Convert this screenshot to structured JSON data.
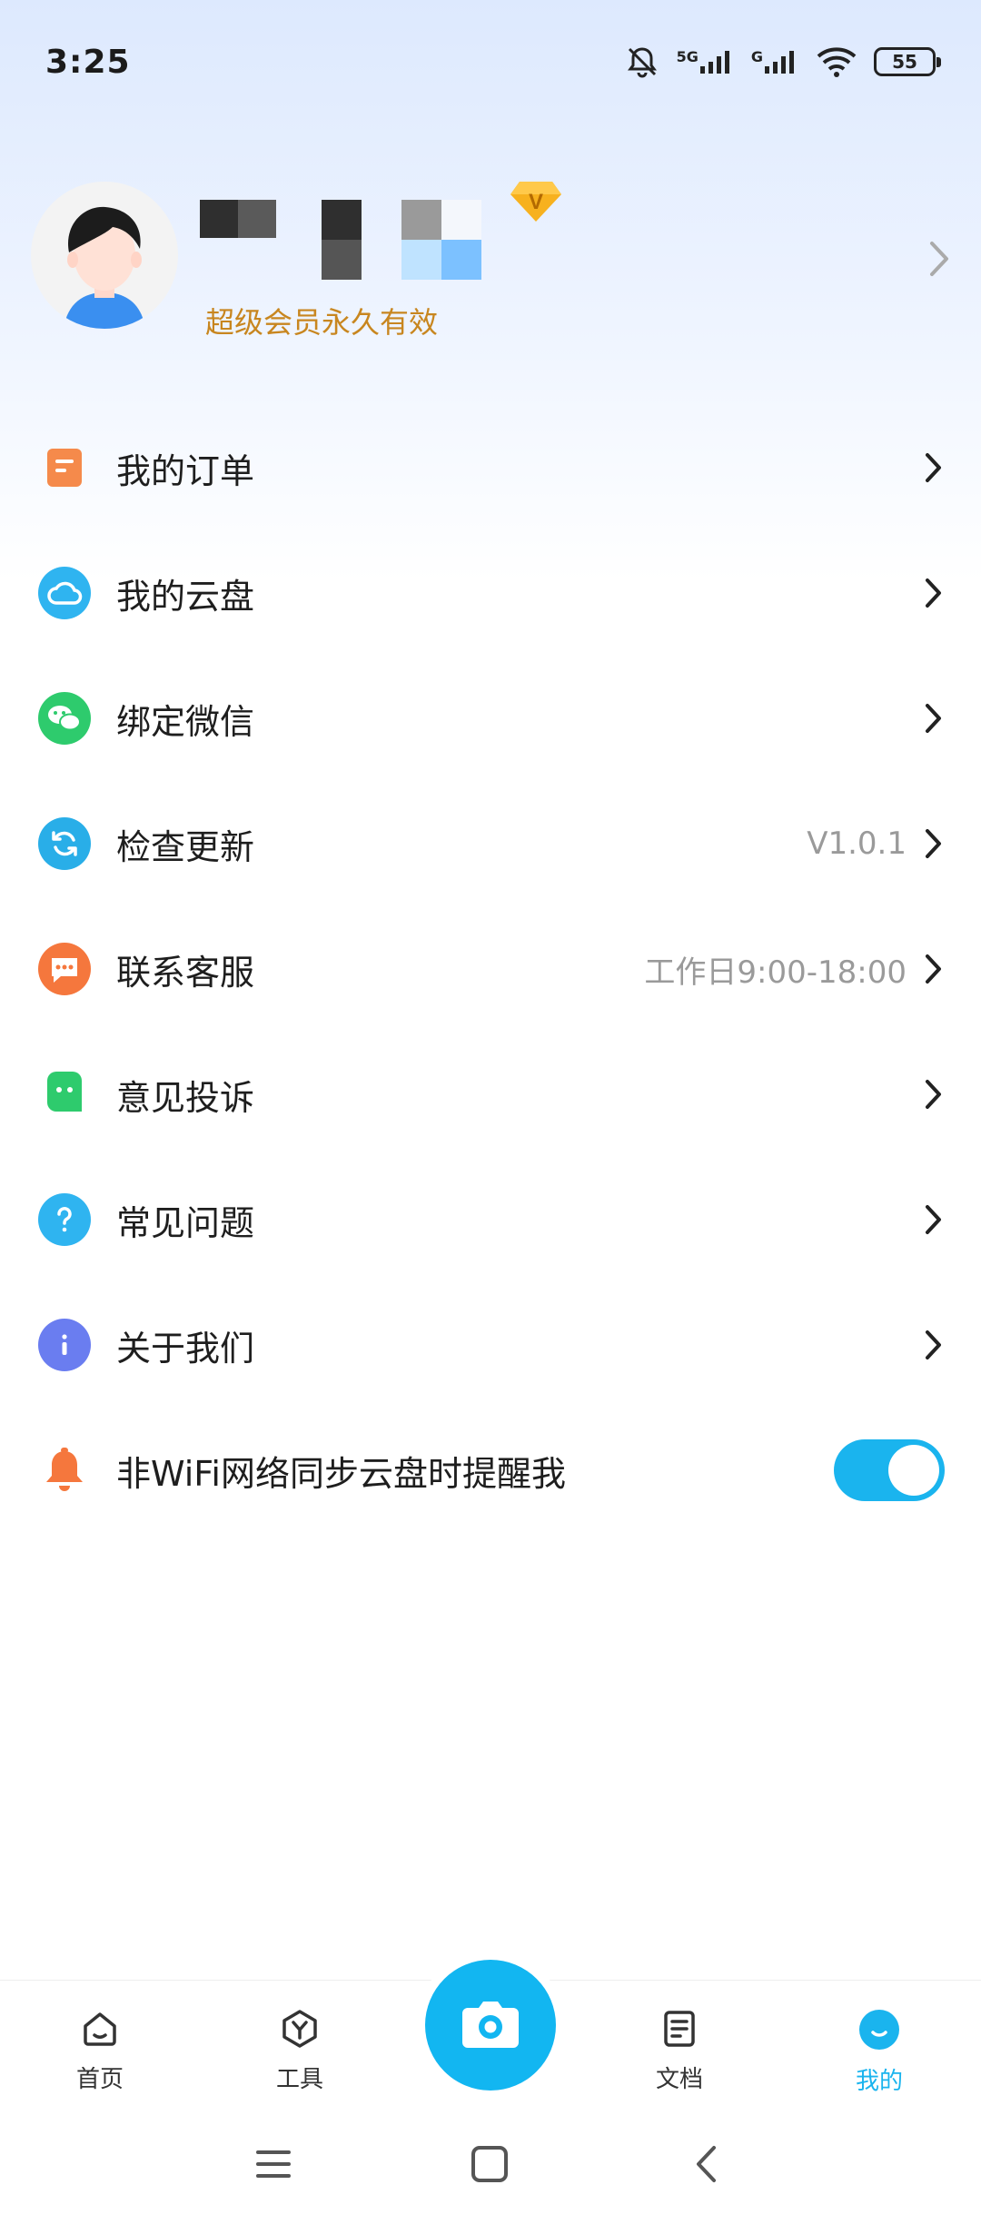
{
  "status_bar": {
    "time": "3:25",
    "network_5g": "5G",
    "network_g": "G",
    "battery": "55"
  },
  "profile": {
    "member_status": "超级会员永久有效",
    "vip_badge_letter": "V",
    "username_pixelated": true
  },
  "menu": [
    {
      "label": "我的订单",
      "value": "",
      "icon": "order-icon",
      "color": "#f58a4b"
    },
    {
      "label": "我的云盘",
      "value": "",
      "icon": "cloud-icon",
      "color": "#2fb4f0"
    },
    {
      "label": "绑定微信",
      "value": "",
      "icon": "wechat-icon",
      "color": "#2ecb6d"
    },
    {
      "label": "检查更新",
      "value": "V1.0.1",
      "icon": "refresh-icon",
      "color": "#29aee8"
    },
    {
      "label": "联系客服",
      "value": "工作日9:00-18:00",
      "icon": "chat-icon",
      "color": "#f5773d"
    },
    {
      "label": "意见投诉",
      "value": "",
      "icon": "feedback-icon",
      "color": "#2ecb6d"
    },
    {
      "label": "常见问题",
      "value": "",
      "icon": "question-icon",
      "color": "#2fb4f0"
    },
    {
      "label": "关于我们",
      "value": "",
      "icon": "info-icon",
      "color": "#6a7df0"
    }
  ],
  "wifi_toggle": {
    "label": "非WiFi网络同步云盘时提醒我",
    "icon": "bell-icon",
    "enabled": true
  },
  "bottom_nav": [
    {
      "label": "首页",
      "icon": "home-icon",
      "active": false
    },
    {
      "label": "工具",
      "icon": "tools-icon",
      "active": false
    },
    {
      "label": "文档",
      "icon": "document-icon",
      "active": false
    },
    {
      "label": "我的",
      "icon": "profile-icon",
      "active": true
    }
  ],
  "colors": {
    "accent": "#1ab4ee",
    "member_gold": "#c8861f"
  }
}
